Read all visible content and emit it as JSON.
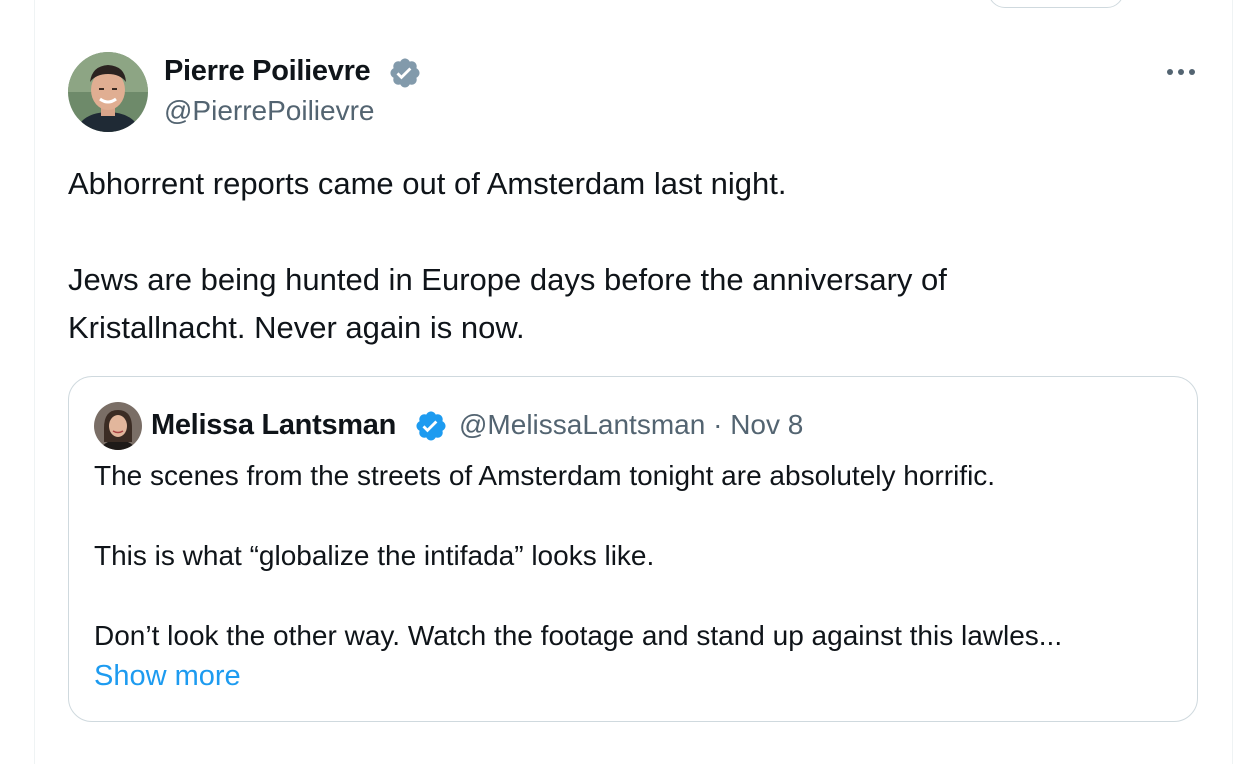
{
  "tweet": {
    "author": {
      "name": "Pierre Poilievre",
      "handle": "@PierrePoilievre"
    },
    "text_lines": [
      "Abhorrent reports came out of Amsterdam last night.",
      "Jews are being hunted in Europe days before the anniversary of",
      "Kristallnacht. Never again is now."
    ]
  },
  "quoted_tweet": {
    "author": {
      "name": "Melissa Lantsman",
      "handle": "@MelissaLantsman",
      "separator": "·",
      "date": "Nov 8"
    },
    "text_lines": [
      "The scenes from the streets of Amsterdam tonight are absolutely horrific.",
      "This is what “globalize the intifada” looks like.",
      "Don’t look the other way. Watch the footage and stand up against this lawles..."
    ],
    "show_more_label": "Show more"
  },
  "icons": {
    "more": "more-horizontal-icon",
    "verified": "verified-badge-icon"
  },
  "colors": {
    "verified_main": "#829aab",
    "verified_quote": "#1d9bf0",
    "link": "#1d9bf0",
    "secondary_text": "#536471",
    "border": "#cfd9de"
  }
}
